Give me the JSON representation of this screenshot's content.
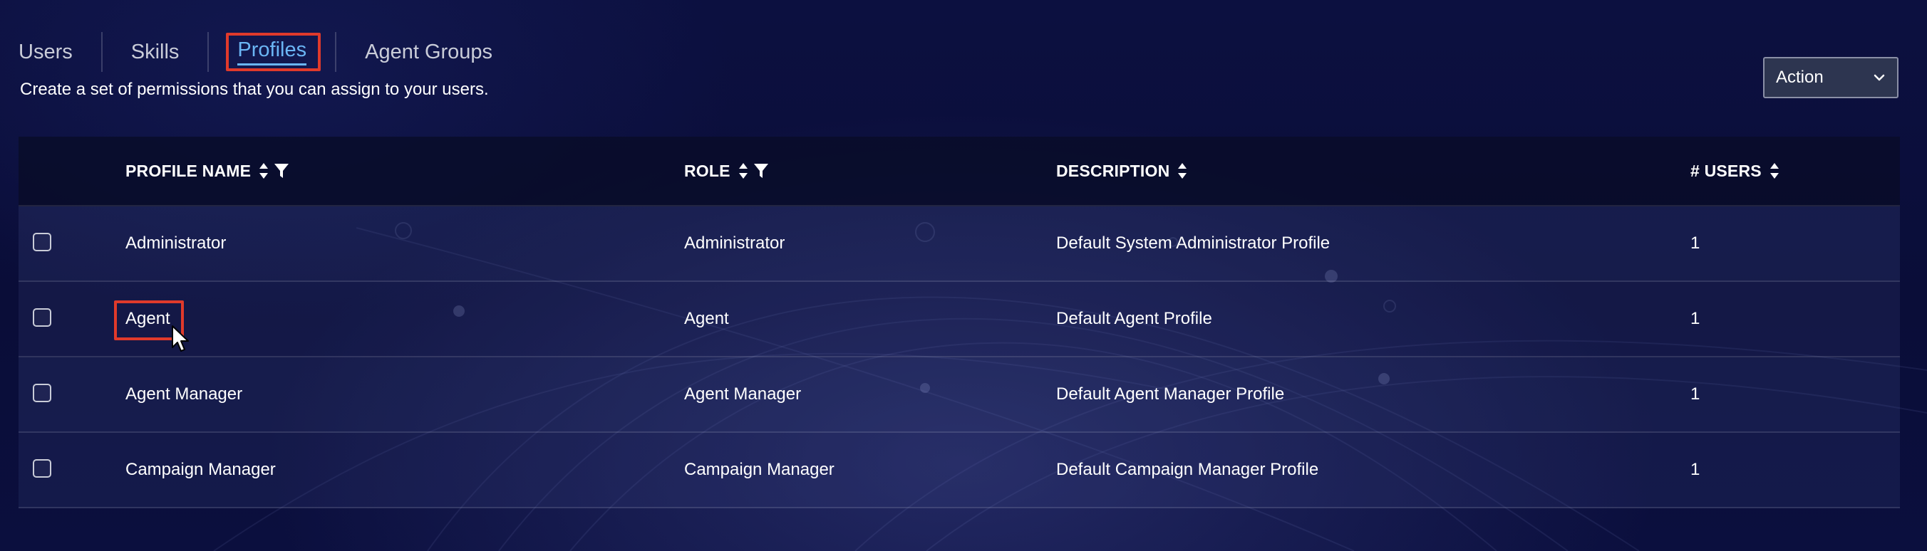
{
  "tabs": [
    {
      "label": "Users",
      "active": false
    },
    {
      "label": "Skills",
      "active": false
    },
    {
      "label": "Profiles",
      "active": true
    },
    {
      "label": "Agent Groups",
      "active": false
    }
  ],
  "subtitle": "Create a set of permissions that you can assign to your users.",
  "action": {
    "selected": "Action"
  },
  "table": {
    "columns": {
      "name": "PROFILE NAME",
      "role": "ROLE",
      "description": "DESCRIPTION",
      "users": "# USERS"
    },
    "rows": [
      {
        "name": "Administrator",
        "role": "Administrator",
        "description": "Default System Administrator Profile",
        "users": "1"
      },
      {
        "name": "Agent",
        "role": "Agent",
        "description": "Default Agent Profile",
        "users": "1"
      },
      {
        "name": "Agent Manager",
        "role": "Agent Manager",
        "description": "Default Agent Manager Profile",
        "users": "1"
      },
      {
        "name": "Campaign Manager",
        "role": "Campaign Manager",
        "description": "Default Campaign Manager Profile",
        "users": "1"
      }
    ]
  },
  "colors": {
    "accent": "#6bb6f5",
    "highlight": "#e03a2b",
    "background": "#0c1040"
  },
  "icons": [
    "sort-icon",
    "filter-icon",
    "chevron-down-icon",
    "mouse-cursor-icon"
  ]
}
